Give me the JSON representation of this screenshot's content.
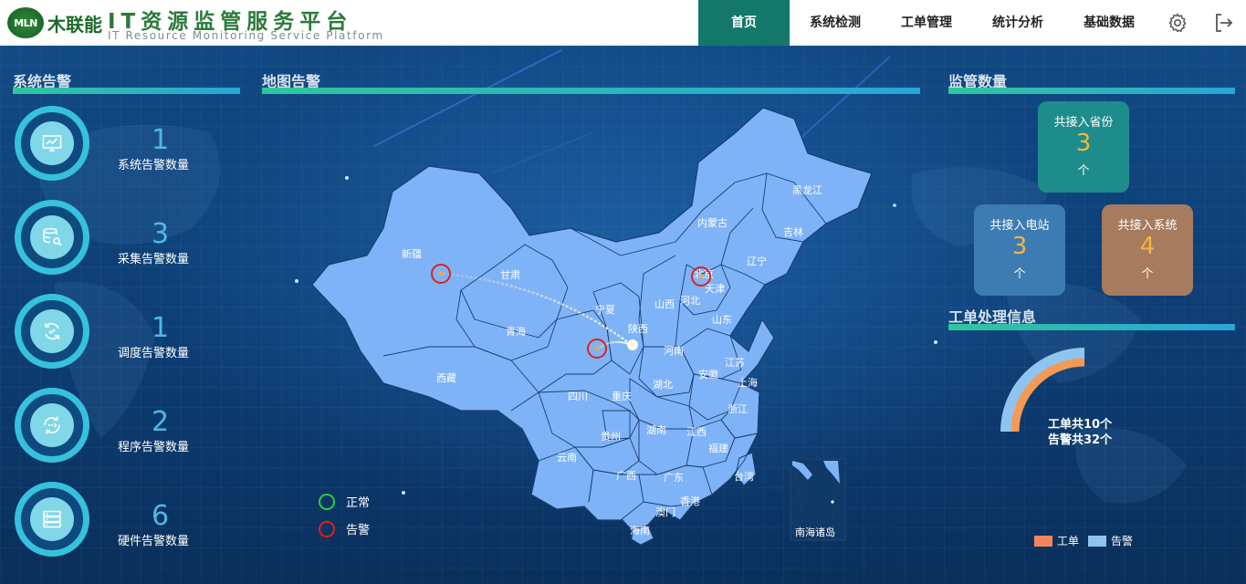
{
  "header": {
    "logo_text": "MLN",
    "brand": "木联能",
    "title": "IT资源监管服务平台",
    "subtitle": "IT Resource Monitoring Service Platform",
    "nav": [
      {
        "label": "首页",
        "active": true
      },
      {
        "label": "系统检测",
        "active": false
      },
      {
        "label": "工单管理",
        "active": false
      },
      {
        "label": "统计分析",
        "active": false
      },
      {
        "label": "基础数据",
        "active": false
      }
    ],
    "icons": [
      "gear-icon",
      "logout-icon"
    ]
  },
  "system_alarms": {
    "title": "系统告警",
    "items": [
      {
        "count": "1",
        "label": "系统告警数量",
        "icon": "monitor-chart-icon"
      },
      {
        "count": "3",
        "label": "采集告警数量",
        "icon": "database-search-icon"
      },
      {
        "count": "1",
        "label": "调度告警数量",
        "icon": "refresh-cycle-icon"
      },
      {
        "count": "2",
        "label": "程序告警数量",
        "icon": "program-sync-icon"
      },
      {
        "count": "6",
        "label": "硬件告警数量",
        "icon": "server-rack-icon"
      }
    ]
  },
  "map": {
    "title": "地图告警",
    "provinces": [
      "新疆",
      "甘肃",
      "青海",
      "西藏",
      "内蒙古",
      "黑龙江",
      "吉林",
      "辽宁",
      "北京",
      "天津",
      "河北",
      "山西",
      "宁夏",
      "陕西",
      "山东",
      "河南",
      "江苏",
      "上海",
      "安徽",
      "湖北",
      "四川",
      "重庆",
      "浙江",
      "湖南",
      "江西",
      "贵州",
      "福建",
      "云南",
      "广西",
      "广东",
      "台湾",
      "香港",
      "澳门",
      "海南"
    ],
    "inset_label": "南海诸岛",
    "alarm_markers": [
      "新疆",
      "北京",
      "四川"
    ],
    "legend": [
      {
        "label": "正常",
        "color": "#2ecc40"
      },
      {
        "label": "告警",
        "color": "#e0201b"
      }
    ]
  },
  "supervision": {
    "title": "监管数量",
    "cards": [
      {
        "title": "共接入省份",
        "value": "3",
        "unit": "个",
        "color": "#1f8c8c"
      },
      {
        "title": "共接入电站",
        "value": "3",
        "unit": "个",
        "color": "#3d7cb2"
      },
      {
        "title": "共接入系统",
        "value": "4",
        "unit": "个",
        "color": "#a67b5e"
      }
    ]
  },
  "work_orders": {
    "title": "工单处理信息",
    "line1": "工单共10个",
    "line2": "告警共32个",
    "work_order_total": 10,
    "alarm_total": 32,
    "colors": {
      "work_order": "#f49a55",
      "alarm": "#8ec4ef"
    },
    "legend": [
      {
        "label": "工单",
        "color": "#f4855a"
      },
      {
        "label": "告警",
        "color": "#8ec4ef"
      }
    ]
  }
}
